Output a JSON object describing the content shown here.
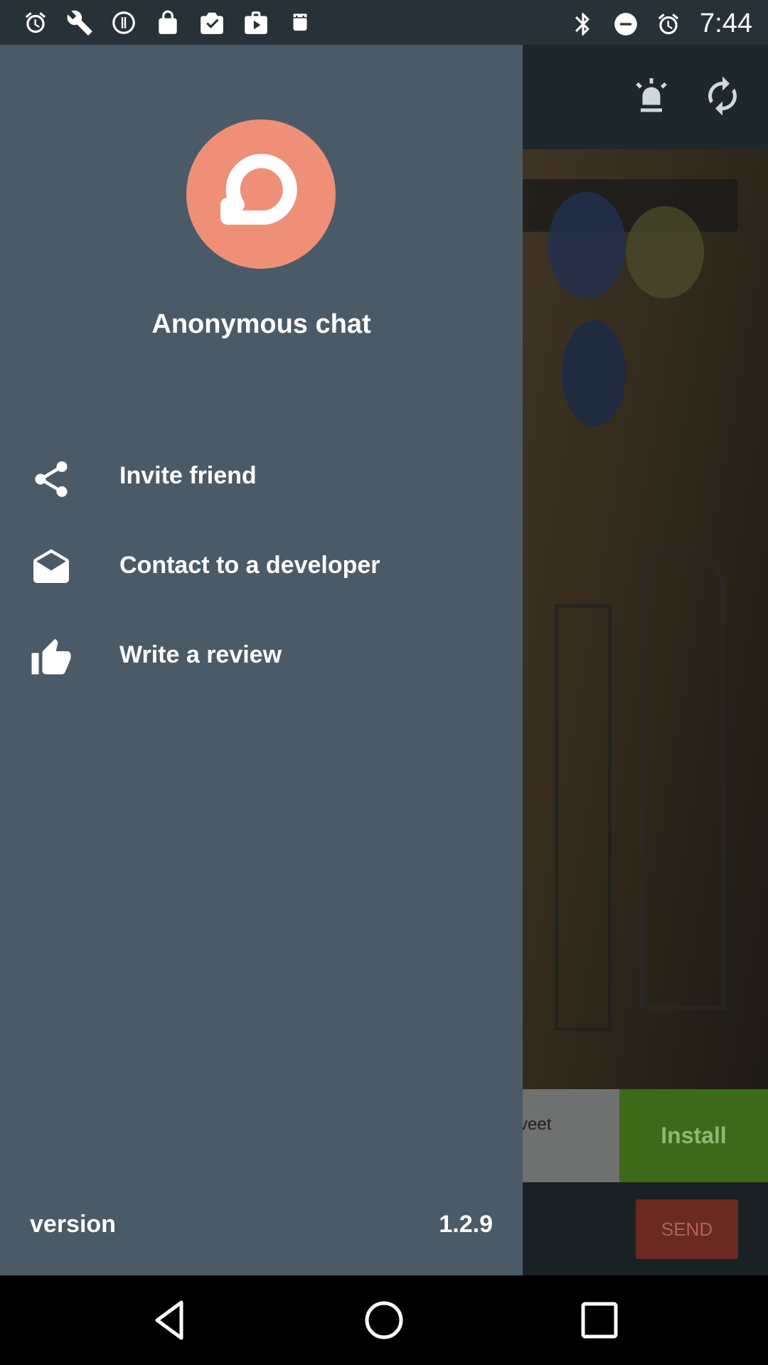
{
  "status_bar": {
    "time": "7:44",
    "left_icons": [
      "alarm-icon",
      "wrench-icon",
      "info-icon",
      "lock-icon",
      "mail-check-icon",
      "play-store-icon",
      "android-icon"
    ],
    "right_icons": [
      "bluetooth-icon",
      "do-not-disturb-icon",
      "alarm-icon"
    ]
  },
  "app": {
    "toolbar_icons": [
      "alert-bell-icon",
      "refresh-icon"
    ],
    "ad": {
      "text": "veet",
      "install_label": "Install",
      "install_color": "#3c6a19"
    },
    "send_label": "SEND"
  },
  "drawer": {
    "app_name": "Anonymous chat",
    "logo_color": "#ef8f78",
    "background": "#4a5b67",
    "items": [
      {
        "label": "Invite friend",
        "icon": "share-icon"
      },
      {
        "label": "Contact to a developer",
        "icon": "envelope-open-icon"
      },
      {
        "label": "Write a review",
        "icon": "thumbs-up-icon"
      }
    ],
    "version_label": "version",
    "version_value": "1.2.9"
  },
  "nav_bar": {
    "buttons": [
      "back-icon",
      "home-icon",
      "recents-icon"
    ]
  }
}
